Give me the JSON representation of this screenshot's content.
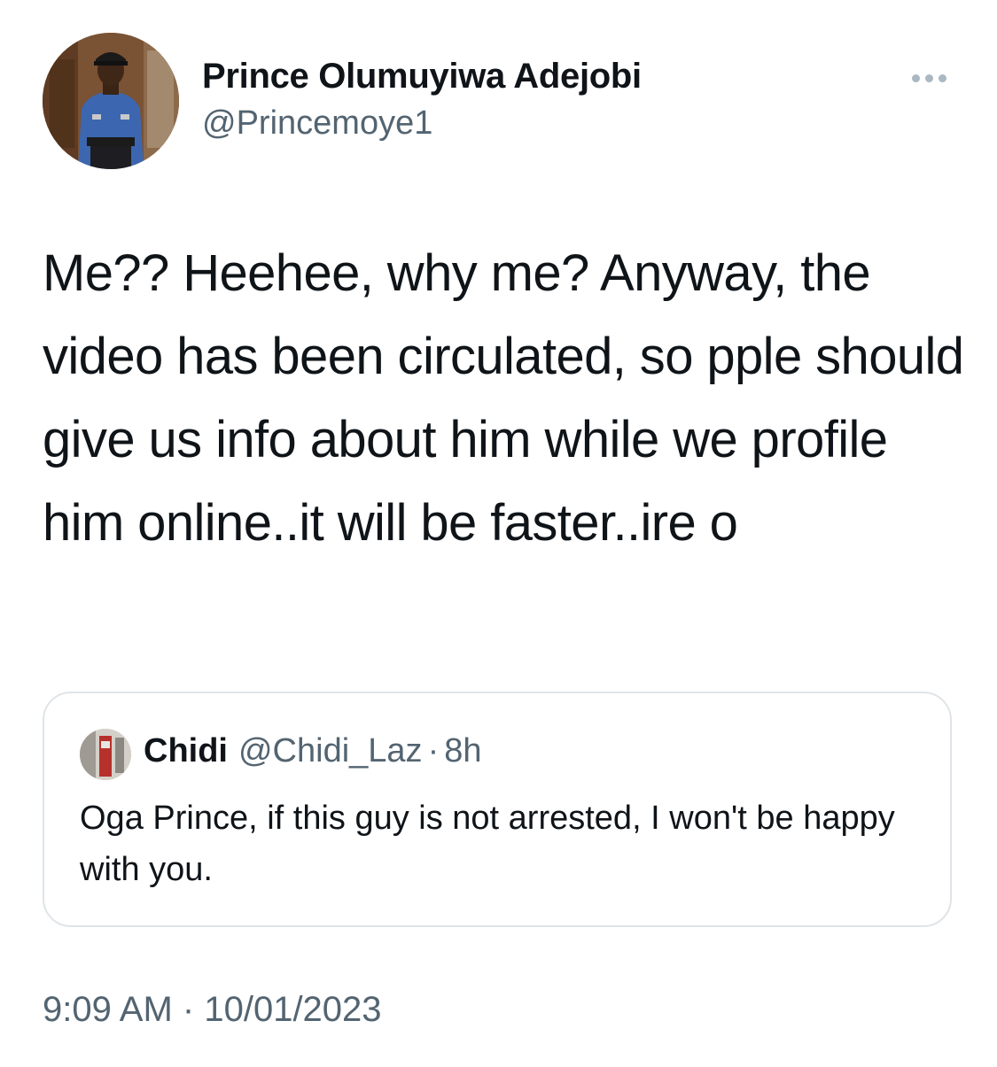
{
  "author": {
    "name": "Prince Olumuyiwa Adejobi",
    "handle": "@Princemoye1"
  },
  "tweet": {
    "text": "Me?? Heehee, why me? Anyway, the video has been circulated, so pple should give us info about him while we profile him online..it will be faster..ire o",
    "time": "9:09 AM",
    "separator": "·",
    "date": "10/01/2023"
  },
  "quoted_tweet": {
    "name": "Chidi",
    "handle": "@Chidi_Laz",
    "separator": "·",
    "age": "8h",
    "text": "Oga Prince, if this guy is not arrested, I won't be happy with you."
  },
  "icons": {
    "more": "more-horizontal-icon"
  },
  "colors": {
    "text": "#0f1419",
    "secondary": "#536471",
    "border": "#dfe4e8"
  }
}
